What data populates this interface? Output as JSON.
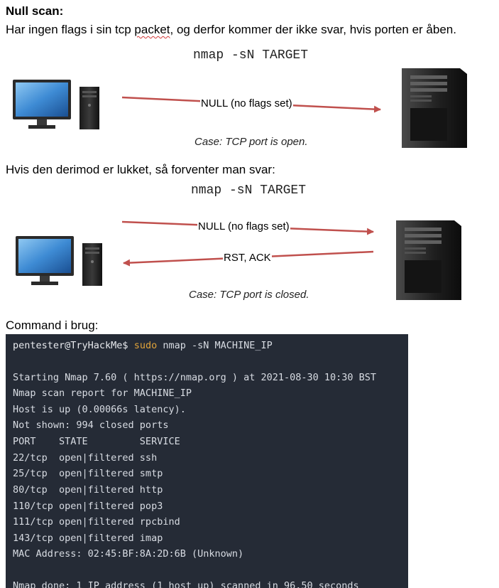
{
  "heading": "Null scan:",
  "intro": {
    "before": "Har ingen flags i sin tcp ",
    "misspelled": "packet",
    "after": ", og derfor kommer der ikke svar, hvis porten er åben."
  },
  "diagram_open": {
    "command": "nmap -sN TARGET",
    "arrow_label": "NULL (no flags set)",
    "caption": "Case: TCP port is open."
  },
  "closed_text": "Hvis den derimod er lukket, så forventer man svar:",
  "diagram_closed": {
    "command": "nmap -sN TARGET",
    "request_label": "NULL (no flags set)",
    "response_label": "RST, ACK",
    "caption": "Case: TCP port is closed."
  },
  "command_label": "Command i brug:",
  "terminal": {
    "prompt": "pentester@TryHackMe$",
    "sudo": "sudo",
    "command": "nmap -sN MACHINE_IP",
    "lines": [
      "Starting Nmap 7.60 ( https://nmap.org ) at 2021-08-30 10:30 BST",
      "Nmap scan report for MACHINE_IP",
      "Host is up (0.00066s latency).",
      "Not shown: 994 closed ports",
      "PORT    STATE         SERVICE",
      "22/tcp  open|filtered ssh",
      "25/tcp  open|filtered smtp",
      "80/tcp  open|filtered http",
      "110/tcp open|filtered pop3",
      "111/tcp open|filtered rpcbind",
      "143/tcp open|filtered imap",
      "MAC Address: 02:45:BF:8A:2D:6B (Unknown)",
      "",
      "Nmap done: 1 IP address (1 host up) scanned in 96.50 seconds"
    ]
  },
  "colors": {
    "arrow": "#c0504d",
    "terminal_bg": "#252b36",
    "sudo": "#e0a33a",
    "spellcheck": "#d23a3a"
  }
}
